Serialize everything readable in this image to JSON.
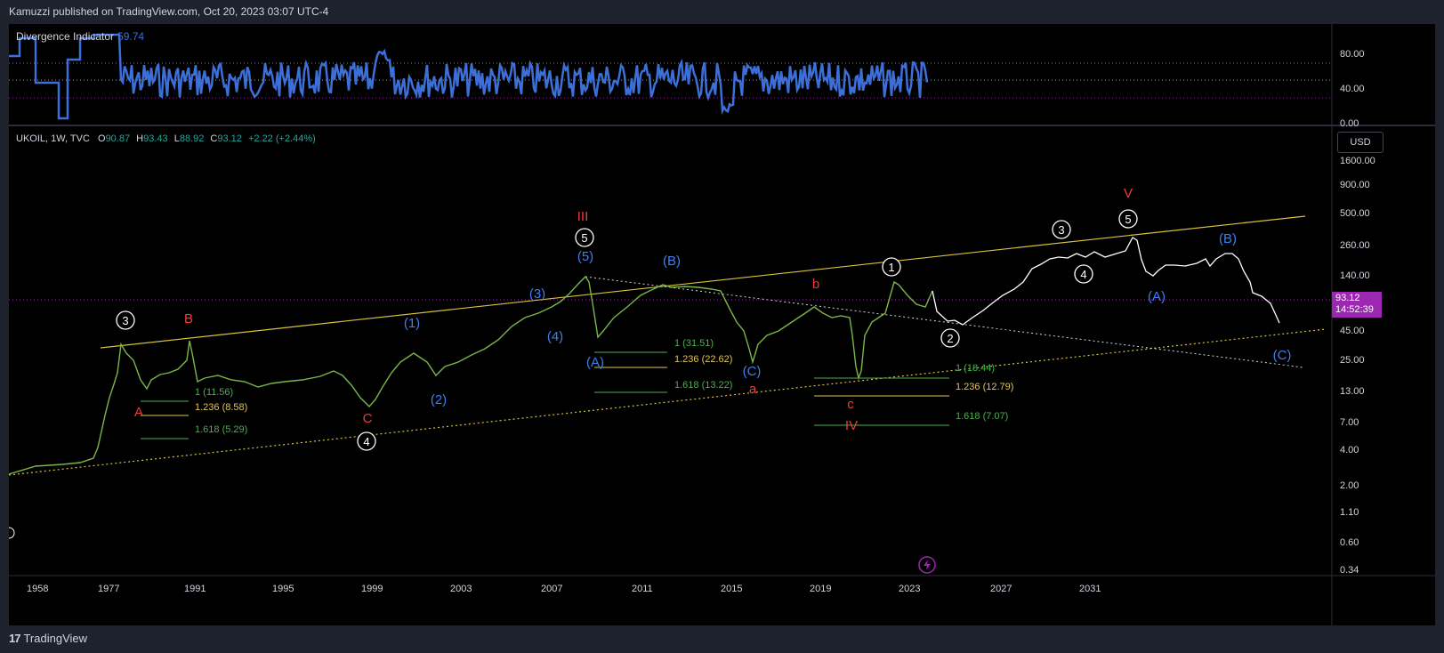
{
  "header": {
    "publisher_line": "Kamuzzi published on TradingView.com, Oct 20, 2023 03:07 UTC-4"
  },
  "indicator": {
    "name": "Divergence Indicator",
    "value": "59.74",
    "y_ticks": [
      "80.00",
      "40.00",
      "0.00"
    ]
  },
  "symbol": {
    "name": "UKOIL, 1W, TVC",
    "open_label": "O",
    "open": "90.87",
    "high_label": "H",
    "high": "93.43",
    "low_label": "L",
    "low": "88.92",
    "close_label": "C",
    "close": "93.12",
    "change": "+2.22 (+2.44%)"
  },
  "currency": "USD",
  "price_tag": {
    "price": "93.12",
    "countdown": "14:52:39"
  },
  "colors": {
    "background": "#000000",
    "frame": "#1e222d",
    "indicator_line": "#3d6fd8",
    "trend_yellow": "#d9c23a",
    "wave_blue": "#3d7ff0",
    "wave_red": "#ef3b3b",
    "fib_green": "#4caf50",
    "fib_yellow": "#e0c45a",
    "price_tag": "#9c27b0"
  },
  "footer": {
    "brand": "TradingView",
    "logo_glyph": "17"
  },
  "chart_data": {
    "type": "line",
    "title": "",
    "xlabel": "",
    "ylabel": "",
    "y_scale": "log",
    "x_tick_labels": [
      "1958",
      "1977",
      "1991",
      "1995",
      "1999",
      "2003",
      "2007",
      "2011",
      "2015",
      "2019",
      "2023",
      "2027",
      "2031"
    ],
    "y_tick_labels": [
      "1600.00",
      "900.00",
      "500.00",
      "260.00",
      "140.00",
      "45.00",
      "25.00",
      "13.00",
      "7.00",
      "4.00",
      "2.00",
      "1.10",
      "0.60",
      "0.34"
    ],
    "grid": false,
    "wave_labels": [
      {
        "text": "3",
        "style": "circle"
      },
      {
        "text": "B",
        "style": "red"
      },
      {
        "text": "A",
        "style": "red"
      },
      {
        "text": "C",
        "style": "red"
      },
      {
        "text": "4",
        "style": "circle"
      },
      {
        "text": "(1)",
        "style": "blue"
      },
      {
        "text": "(2)",
        "style": "blue"
      },
      {
        "text": "(3)",
        "style": "blue"
      },
      {
        "text": "(4)",
        "style": "blue"
      },
      {
        "text": "(5)",
        "style": "blue"
      },
      {
        "text": "5",
        "style": "circle"
      },
      {
        "text": "III",
        "style": "red"
      },
      {
        "text": "(A)",
        "style": "blue"
      },
      {
        "text": "(B)",
        "style": "blue"
      },
      {
        "text": "(C)",
        "style": "blue"
      },
      {
        "text": "a",
        "style": "red"
      },
      {
        "text": "b",
        "style": "red"
      },
      {
        "text": "c",
        "style": "red"
      },
      {
        "text": "IV",
        "style": "red"
      },
      {
        "text": "1",
        "style": "circle"
      },
      {
        "text": "2",
        "style": "circle"
      },
      {
        "text": "3",
        "style": "circle"
      },
      {
        "text": "4",
        "style": "circle"
      },
      {
        "text": "5",
        "style": "circle"
      },
      {
        "text": "V",
        "style": "red"
      },
      {
        "text": "(A)",
        "style": "blue"
      },
      {
        "text": "(B)",
        "style": "blue"
      },
      {
        "text": "(C)",
        "style": "blue"
      }
    ],
    "fib_labels": [
      {
        "text": "1 (11.56)",
        "color": "#4caf50"
      },
      {
        "text": "1.236 (8.58)",
        "color": "#e0c45a"
      },
      {
        "text": "1.618 (5.29)",
        "color": "#4caf50"
      },
      {
        "text": "1 (31.51)",
        "color": "#4caf50"
      },
      {
        "text": "1.236 (22.62)",
        "color": "#e0c45a"
      },
      {
        "text": "1.618 (13.22)",
        "color": "#4caf50"
      },
      {
        "text": "1 (18.44)",
        "color": "#4caf50"
      },
      {
        "text": "1.236 (12.79)",
        "color": "#e0c45a"
      },
      {
        "text": "1.618 (7.07)",
        "color": "#4caf50"
      }
    ]
  }
}
